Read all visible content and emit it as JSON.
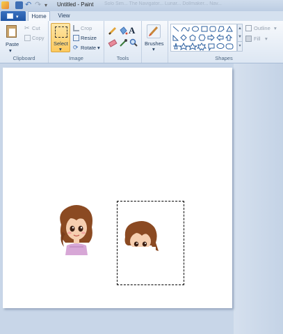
{
  "window": {
    "title": "Untitled - Paint",
    "background_tabs": "Solo Sim...  The Navigator...      Lunar... Dollmaker...  Nav..."
  },
  "ribbon_tabs": [
    {
      "label": "Home",
      "active": true
    },
    {
      "label": "View",
      "active": false
    }
  ],
  "groups": {
    "clipboard": {
      "label": "Clipboard",
      "paste": "Paste",
      "cut": "Cut",
      "copy": "Copy"
    },
    "image": {
      "label": "Image",
      "select": "Select",
      "crop": "Crop",
      "resize": "Resize",
      "rotate": "Rotate"
    },
    "tools": {
      "label": "Tools",
      "items": [
        "pencil-icon",
        "fill-bucket-icon",
        "text-icon",
        "eraser-icon",
        "color-picker-icon",
        "magnifier-icon"
      ]
    },
    "brushes": {
      "label": "Brushes"
    },
    "shapes": {
      "label": "Shapes",
      "outline": "Outline",
      "fill": "Fill"
    }
  },
  "colors": {
    "accent_select": "#fbc95d",
    "ribbon_bg": "#dde7f3",
    "workspace_bg": "#c8d6e8"
  }
}
